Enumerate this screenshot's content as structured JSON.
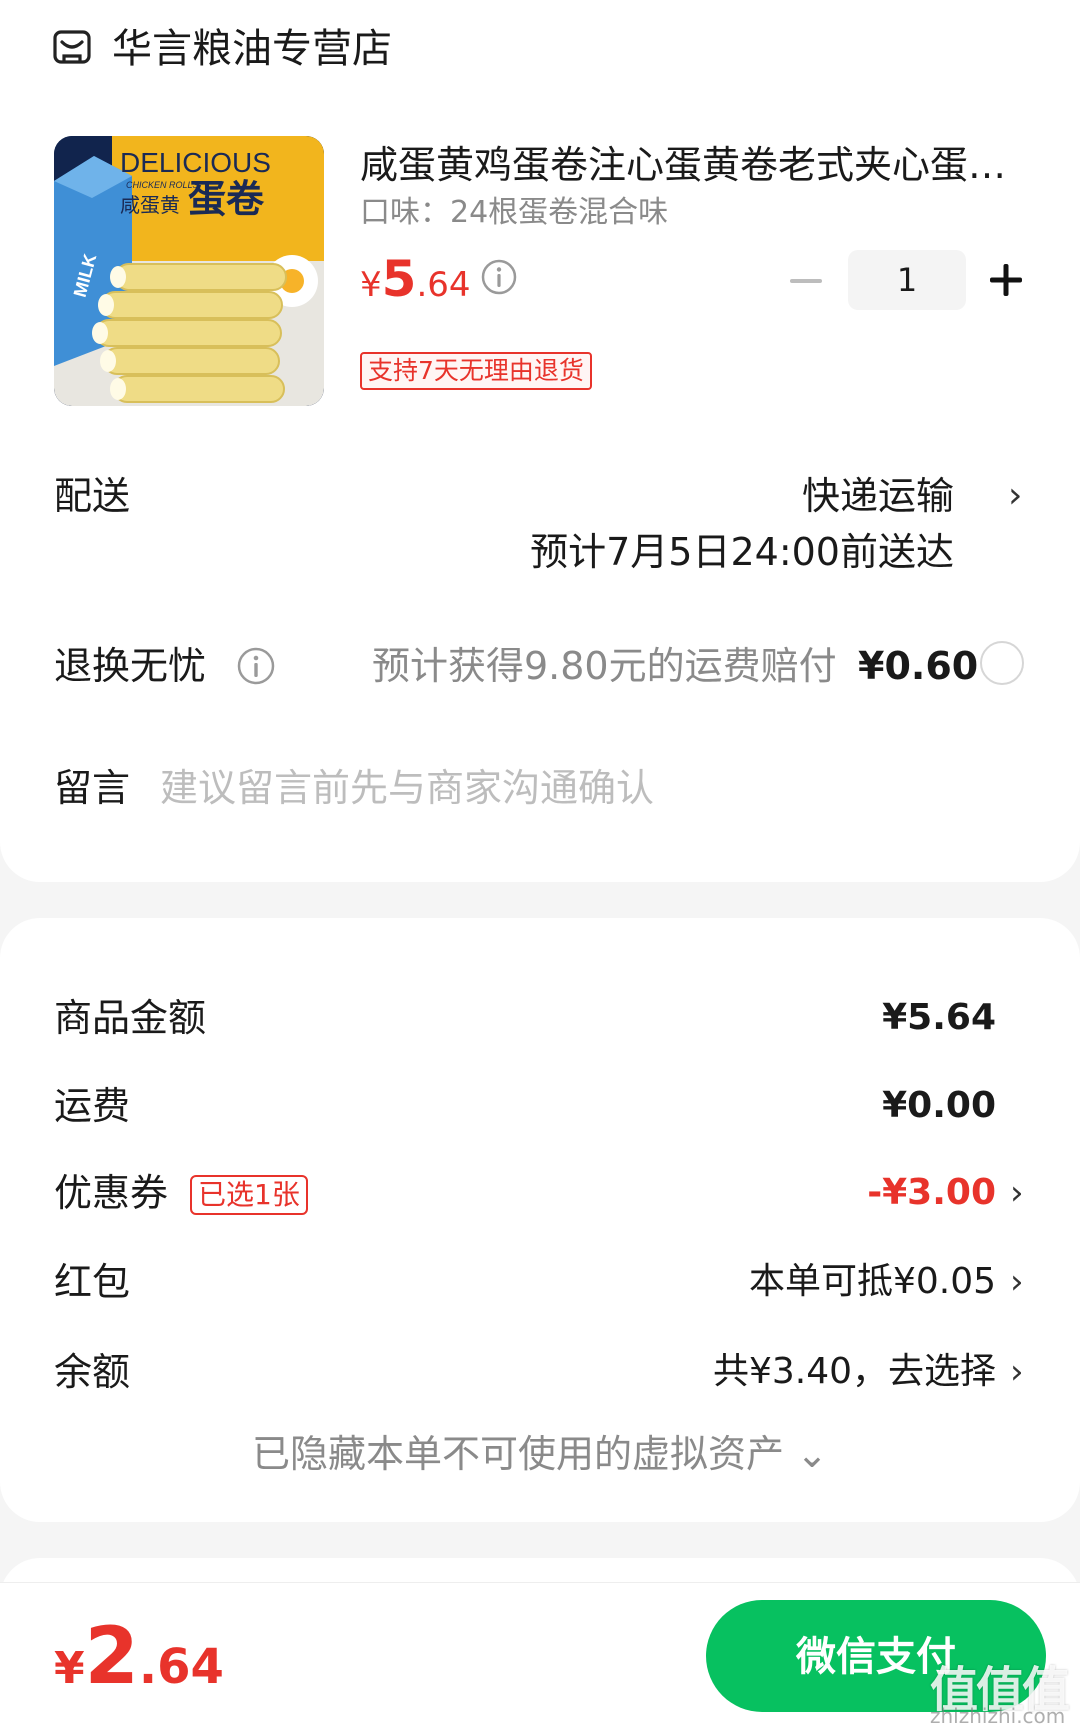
{
  "shop": {
    "name": "华言粮油专营店",
    "icon": "store-icon"
  },
  "product": {
    "title": "咸蛋黄鸡蛋卷注心蛋黄卷老式夹心蛋…",
    "spec": "口味：24根蛋卷混合味",
    "price_currency": "¥",
    "price_int": "5",
    "price_dec": ".64",
    "quantity": "1",
    "return_badge": "支持7天无理由退货",
    "image_text": {
      "brand": "DELICIOUS",
      "sub": "CHICKEN ROLLS",
      "cn_small": "咸蛋黄",
      "cn_big": "蛋卷",
      "milk": "MILK"
    }
  },
  "shipping": {
    "label": "配送",
    "method": "快递运输",
    "eta": "预计7月5日24:00前送达"
  },
  "return_insurance": {
    "label": "退换无忧",
    "desc": "预计获得9.80元的运费赔付",
    "price": "¥0.60",
    "selected": false
  },
  "message": {
    "label": "留言",
    "placeholder": "建议留言前先与商家沟通确认"
  },
  "summary": {
    "goods_label": "商品金额",
    "goods_value": "¥5.64",
    "freight_label": "运费",
    "freight_value": "¥0.00",
    "coupon_label": "优惠券",
    "coupon_badge": "已选1张",
    "coupon_value": "-¥3.00",
    "redpacket_label": "红包",
    "redpacket_value": "本单可抵¥0.05",
    "balance_label": "余额",
    "balance_value": "共¥3.40，去选择",
    "hidden_assets": "已隐藏本单不可使用的虚拟资产 ⌄"
  },
  "footer": {
    "total_currency": "¥",
    "total_int": "2",
    "total_dec": ".64",
    "pay_label": "微信支付",
    "watermark": "值值值",
    "watermark_sub": "zhizhizhi.com"
  },
  "colors": {
    "accent": "#e8332b",
    "pay": "#07c160"
  }
}
